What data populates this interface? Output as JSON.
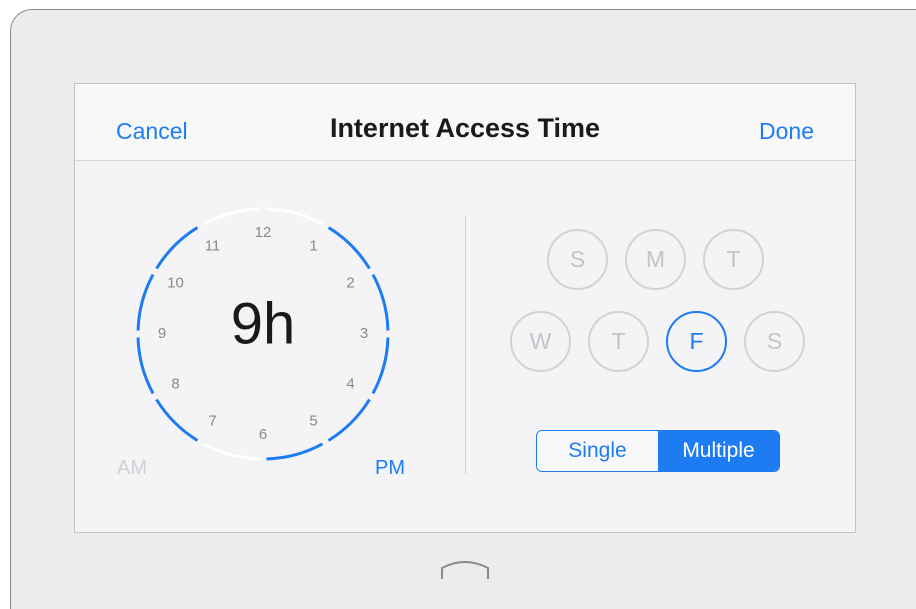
{
  "navbar": {
    "cancel_label": "Cancel",
    "title": "Internet Access Time",
    "done_label": "Done"
  },
  "clock": {
    "hours": [
      "12",
      "1",
      "2",
      "3",
      "4",
      "5",
      "6",
      "7",
      "8",
      "9",
      "10",
      "11"
    ],
    "value": "9h",
    "active_hours": 9,
    "am_label": "AM",
    "pm_label": "PM",
    "selected_period": "PM"
  },
  "days": {
    "items": [
      {
        "label": "S",
        "selected": false
      },
      {
        "label": "M",
        "selected": false
      },
      {
        "label": "T",
        "selected": false
      },
      {
        "label": "W",
        "selected": false
      },
      {
        "label": "T",
        "selected": false
      },
      {
        "label": "F",
        "selected": true
      },
      {
        "label": "S",
        "selected": false
      }
    ]
  },
  "mode": {
    "single_label": "Single",
    "multiple_label": "Multiple",
    "selected": "Multiple"
  },
  "colors": {
    "accent": "#1d7cf2",
    "inactive_ring": "#ffffff",
    "day_inactive": "#c4c4c8"
  },
  "icons": {
    "home": "home-button-icon"
  }
}
